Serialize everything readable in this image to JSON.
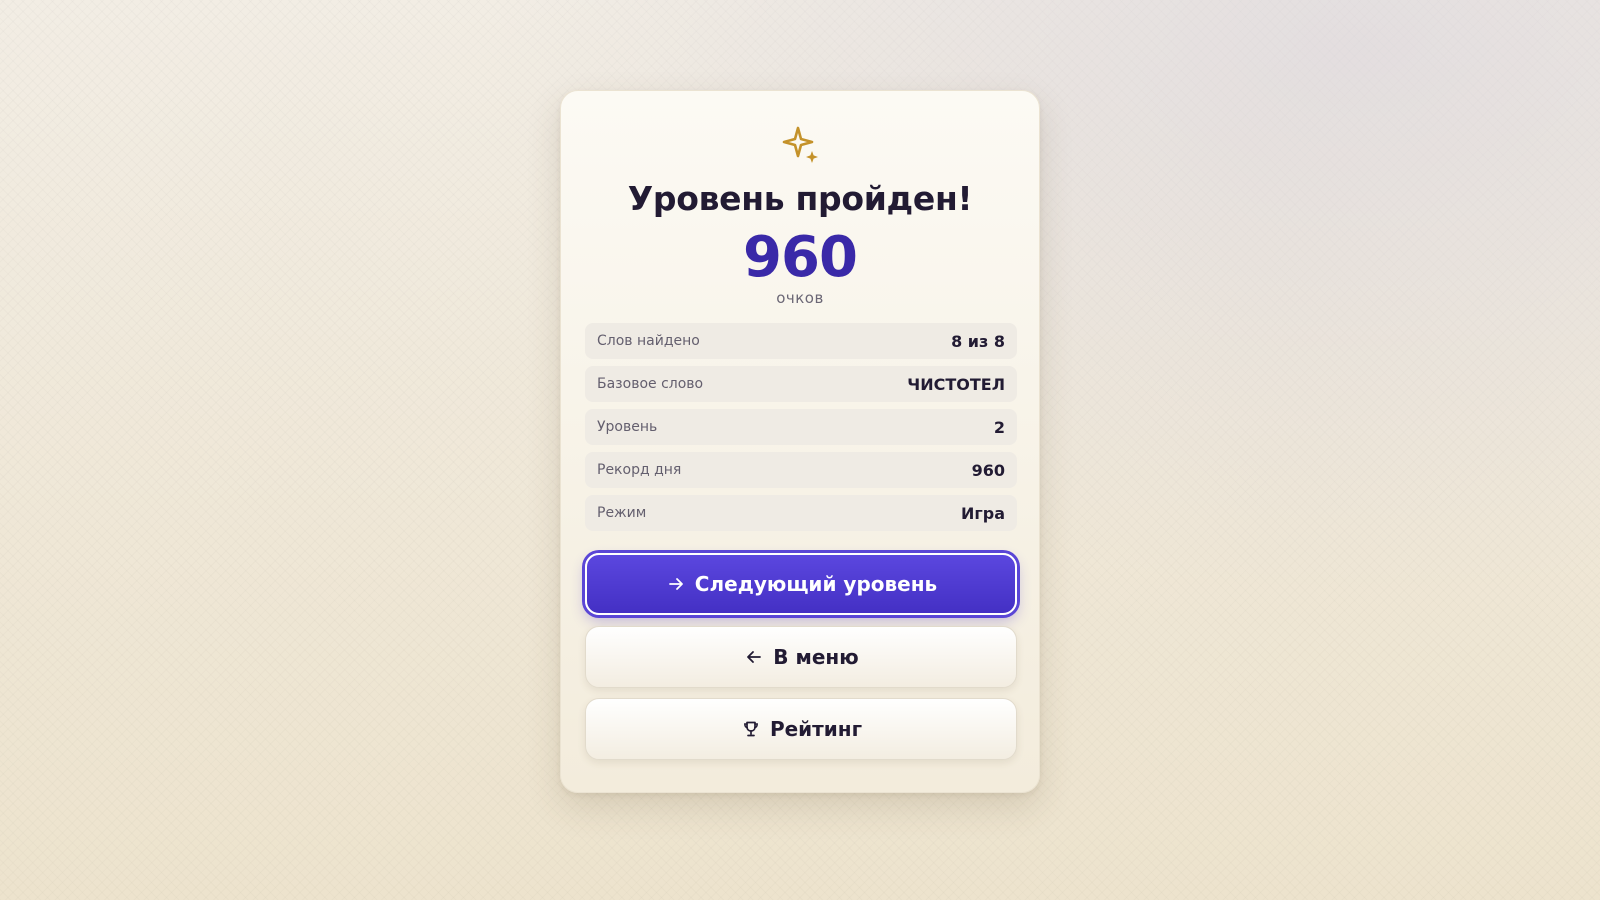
{
  "result_card": {
    "title": "Уровень пройден!",
    "score": "960",
    "score_unit": "очков",
    "stats": [
      {
        "label": "Слов найдено",
        "value": "8 из 8"
      },
      {
        "label": "Базовое слово",
        "value": "ЧИСТОТЕЛ"
      },
      {
        "label": "Уровень",
        "value": "2"
      },
      {
        "label": "Рекорд дня",
        "value": "960"
      },
      {
        "label": "Режим",
        "value": "Игра"
      }
    ],
    "buttons": {
      "next_level": "Следующий уровень",
      "menu": "В меню",
      "rating": "Рейтинг"
    }
  },
  "icons": {
    "header": "sparkle-icon",
    "next_level": "arrow-right-icon",
    "menu": "arrow-left-icon",
    "rating": "trophy-icon"
  },
  "colors": {
    "accent": "#4a36cc",
    "score": "#3a29a8",
    "sparkle": "#c4922a",
    "text_dark": "#221b33"
  }
}
